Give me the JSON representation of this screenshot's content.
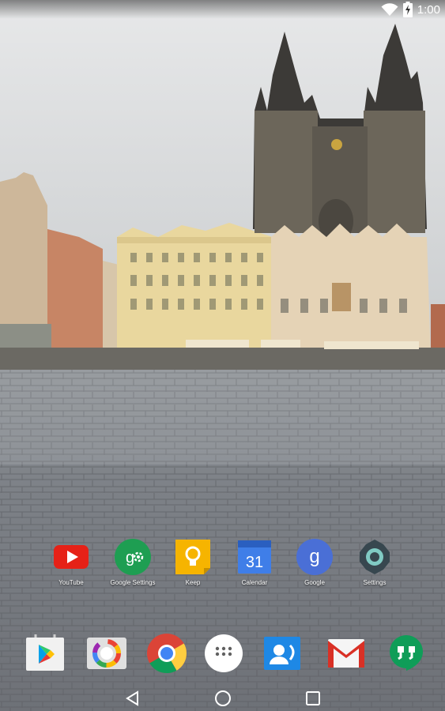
{
  "status_bar": {
    "time": "1:00",
    "icons": [
      "wifi-icon",
      "battery-charging-icon"
    ]
  },
  "home": {
    "apps": [
      {
        "name": "youtube",
        "label": "YouTube",
        "icon": "youtube-icon",
        "color": "#e62117"
      },
      {
        "name": "google-settings",
        "label": "Google Settings",
        "icon": "google-settings-icon",
        "color": "#1e9e52"
      },
      {
        "name": "keep",
        "label": "Keep",
        "icon": "keep-icon",
        "color": "#f6b400"
      },
      {
        "name": "calendar",
        "label": "Calendar",
        "icon": "calendar-icon",
        "color": "#3f7ee8",
        "day": "31"
      },
      {
        "name": "google",
        "label": "Google",
        "icon": "google-icon",
        "color": "#4a6fd6",
        "glyph": "g"
      },
      {
        "name": "settings",
        "label": "Settings",
        "icon": "settings-icon",
        "color": "#37474f"
      }
    ],
    "dock": [
      {
        "name": "play-store",
        "icon": "play-store-icon"
      },
      {
        "name": "photos",
        "icon": "photos-icon"
      },
      {
        "name": "chrome",
        "icon": "chrome-icon"
      },
      {
        "name": "app-drawer",
        "icon": "app-drawer-icon"
      },
      {
        "name": "contacts",
        "icon": "contacts-icon"
      },
      {
        "name": "gmail",
        "icon": "gmail-icon"
      },
      {
        "name": "hangouts",
        "icon": "hangouts-icon"
      }
    ]
  },
  "nav_bar": {
    "buttons": [
      "back-icon",
      "home-icon",
      "recents-icon"
    ]
  }
}
